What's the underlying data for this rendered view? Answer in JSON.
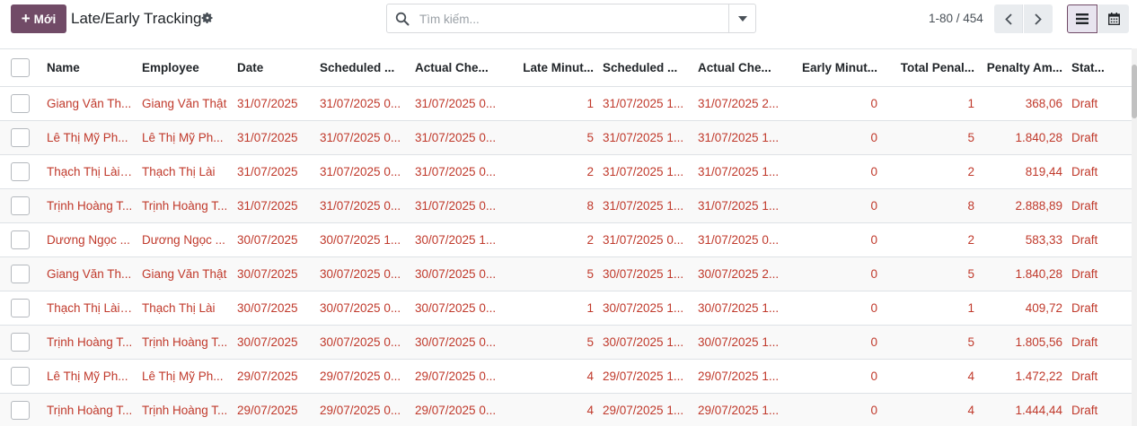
{
  "control_panel": {
    "new_button_label": "Mới",
    "title": "Late/Early Tracking",
    "search_placeholder": "Tìm kiếm...",
    "pager_value": "1-80 / 454"
  },
  "columns": [
    {
      "key": "name",
      "label": "Name",
      "align": "left"
    },
    {
      "key": "employee",
      "label": "Employee",
      "align": "left"
    },
    {
      "key": "date",
      "label": "Date",
      "align": "left"
    },
    {
      "key": "scheduled_in",
      "label": "Scheduled ...",
      "align": "left"
    },
    {
      "key": "actual_in",
      "label": "Actual Che...",
      "align": "left"
    },
    {
      "key": "late_minutes",
      "label": "Late Minut...",
      "align": "right"
    },
    {
      "key": "scheduled_out",
      "label": "Scheduled ...",
      "align": "left"
    },
    {
      "key": "actual_out",
      "label": "Actual Che...",
      "align": "left"
    },
    {
      "key": "early_minutes",
      "label": "Early Minut...",
      "align": "right"
    },
    {
      "key": "total_penalty",
      "label": "Total Penal...",
      "align": "right"
    },
    {
      "key": "penalty_amount",
      "label": "Penalty Am...",
      "align": "right"
    },
    {
      "key": "status",
      "label": "Stat...",
      "align": "left"
    }
  ],
  "rows": [
    [
      "Giang Văn Th...",
      "Giang Văn Thật",
      "31/07/2025",
      "31/07/2025 0...",
      "31/07/2025 0...",
      "1",
      "31/07/2025 1...",
      "31/07/2025 2...",
      "0",
      "1",
      "368,06",
      "Draft"
    ],
    [
      "Lê Thị Mỹ Ph...",
      "Lê Thị Mỹ Ph...",
      "31/07/2025",
      "31/07/2025 0...",
      "31/07/2025 0...",
      "5",
      "31/07/2025 1...",
      "31/07/2025 1...",
      "0",
      "5",
      "1.840,28",
      "Draft"
    ],
    [
      "Thạch Thị Lài ...",
      "Thạch Thị Lài",
      "31/07/2025",
      "31/07/2025 0...",
      "31/07/2025 0...",
      "2",
      "31/07/2025 1...",
      "31/07/2025 1...",
      "0",
      "2",
      "819,44",
      "Draft"
    ],
    [
      "Trịnh Hoàng T...",
      "Trịnh Hoàng T...",
      "31/07/2025",
      "31/07/2025 0...",
      "31/07/2025 0...",
      "8",
      "31/07/2025 1...",
      "31/07/2025 1...",
      "0",
      "8",
      "2.888,89",
      "Draft"
    ],
    [
      "Dương Ngọc ...",
      "Dương Ngọc ...",
      "30/07/2025",
      "30/07/2025 1...",
      "30/07/2025 1...",
      "2",
      "31/07/2025 0...",
      "31/07/2025 0...",
      "0",
      "2",
      "583,33",
      "Draft"
    ],
    [
      "Giang Văn Th...",
      "Giang Văn Thật",
      "30/07/2025",
      "30/07/2025 0...",
      "30/07/2025 0...",
      "5",
      "30/07/2025 1...",
      "30/07/2025 2...",
      "0",
      "5",
      "1.840,28",
      "Draft"
    ],
    [
      "Thạch Thị Lài ...",
      "Thạch Thị Lài",
      "30/07/2025",
      "30/07/2025 0...",
      "30/07/2025 0...",
      "1",
      "30/07/2025 1...",
      "30/07/2025 1...",
      "0",
      "1",
      "409,72",
      "Draft"
    ],
    [
      "Trịnh Hoàng T...",
      "Trịnh Hoàng T...",
      "30/07/2025",
      "30/07/2025 0...",
      "30/07/2025 0...",
      "5",
      "30/07/2025 1...",
      "30/07/2025 1...",
      "0",
      "5",
      "1.805,56",
      "Draft"
    ],
    [
      "Lê Thị Mỹ Ph...",
      "Lê Thị Mỹ Ph...",
      "29/07/2025",
      "29/07/2025 0...",
      "29/07/2025 0...",
      "4",
      "29/07/2025 1...",
      "29/07/2025 1...",
      "0",
      "4",
      "1.472,22",
      "Draft"
    ],
    [
      "Trịnh Hoàng T...",
      "Trịnh Hoàng T...",
      "29/07/2025",
      "29/07/2025 0...",
      "29/07/2025 0...",
      "4",
      "29/07/2025 1...",
      "29/07/2025 1...",
      "0",
      "4",
      "1.444,44",
      "Draft"
    ]
  ],
  "colors": {
    "primary": "#714b67",
    "row_text": "#c0392b"
  },
  "icons": {
    "plus": "plus-icon",
    "gear": "gear-icon",
    "search": "search-icon",
    "dropdown": "caret-down-icon",
    "prev": "chevron-left-icon",
    "next": "chevron-right-icon",
    "list_view": "list-view-icon",
    "calendar_view": "calendar-view-icon"
  }
}
